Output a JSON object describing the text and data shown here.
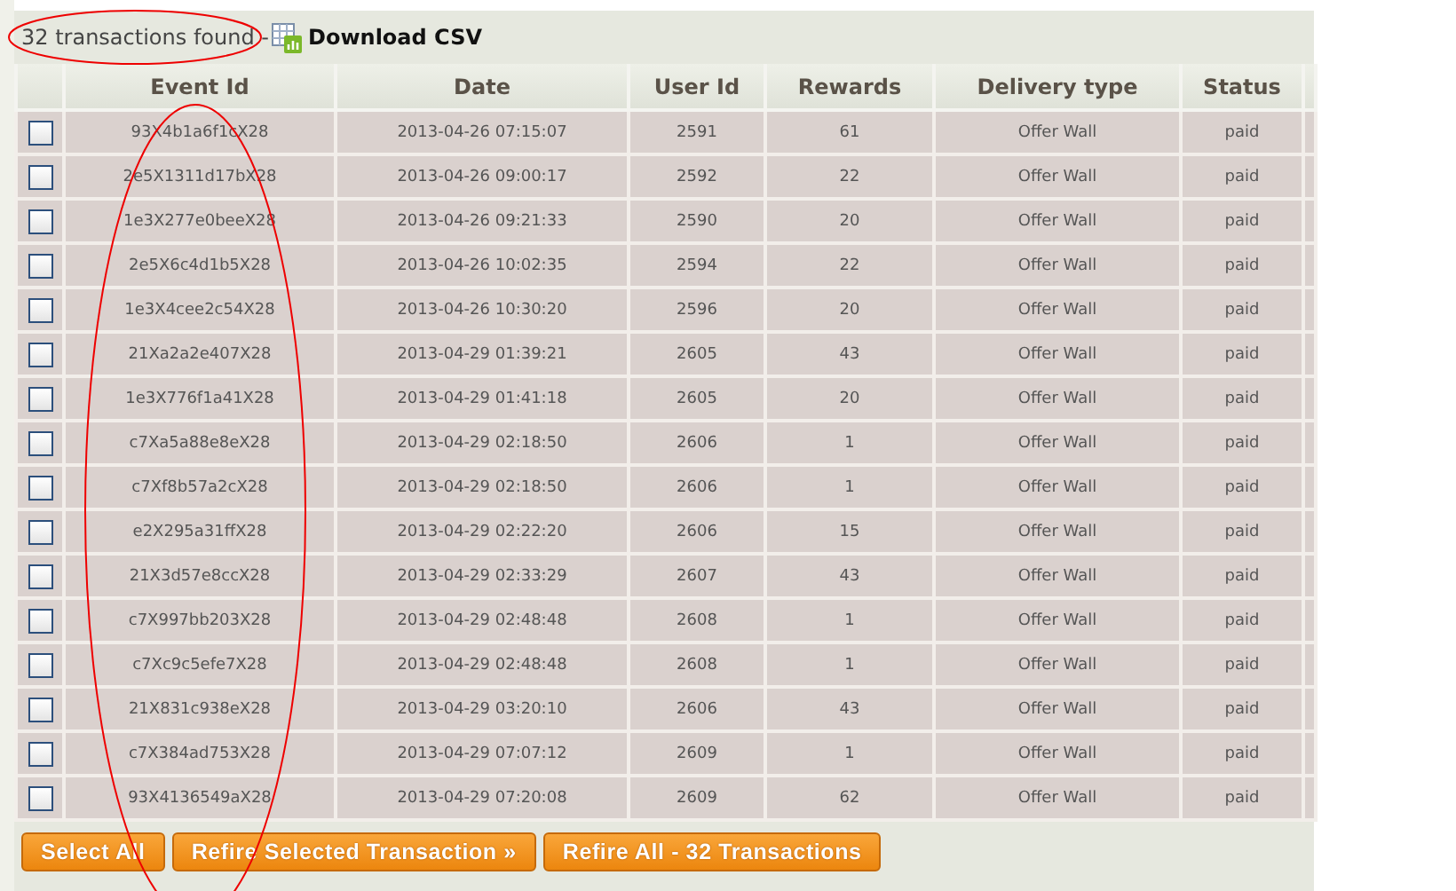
{
  "summary": {
    "count_text": "32 transactions found -",
    "download_link": "Download CSV"
  },
  "table": {
    "columns": [
      "Event Id",
      "Date",
      "User Id",
      "Rewards",
      "Delivery type",
      "Status"
    ],
    "rows": [
      {
        "checked": false,
        "event_id": "93X4b1a6f1cX28",
        "date": "2013-04-26 07:15:07",
        "user_id": "2591",
        "rewards": "61",
        "delivery_type": "Offer Wall",
        "status": "paid"
      },
      {
        "checked": false,
        "event_id": "2e5X1311d17bX28",
        "date": "2013-04-26 09:00:17",
        "user_id": "2592",
        "rewards": "22",
        "delivery_type": "Offer Wall",
        "status": "paid"
      },
      {
        "checked": false,
        "event_id": "1e3X277e0beeX28",
        "date": "2013-04-26 09:21:33",
        "user_id": "2590",
        "rewards": "20",
        "delivery_type": "Offer Wall",
        "status": "paid"
      },
      {
        "checked": false,
        "event_id": "2e5X6c4d1b5X28",
        "date": "2013-04-26 10:02:35",
        "user_id": "2594",
        "rewards": "22",
        "delivery_type": "Offer Wall",
        "status": "paid"
      },
      {
        "checked": false,
        "event_id": "1e3X4cee2c54X28",
        "date": "2013-04-26 10:30:20",
        "user_id": "2596",
        "rewards": "20",
        "delivery_type": "Offer Wall",
        "status": "paid"
      },
      {
        "checked": false,
        "event_id": "21Xa2a2e407X28",
        "date": "2013-04-29 01:39:21",
        "user_id": "2605",
        "rewards": "43",
        "delivery_type": "Offer Wall",
        "status": "paid"
      },
      {
        "checked": false,
        "event_id": "1e3X776f1a41X28",
        "date": "2013-04-29 01:41:18",
        "user_id": "2605",
        "rewards": "20",
        "delivery_type": "Offer Wall",
        "status": "paid"
      },
      {
        "checked": false,
        "event_id": "c7Xa5a88e8eX28",
        "date": "2013-04-29 02:18:50",
        "user_id": "2606",
        "rewards": "1",
        "delivery_type": "Offer Wall",
        "status": "paid"
      },
      {
        "checked": false,
        "event_id": "c7Xf8b57a2cX28",
        "date": "2013-04-29 02:18:50",
        "user_id": "2606",
        "rewards": "1",
        "delivery_type": "Offer Wall",
        "status": "paid"
      },
      {
        "checked": false,
        "event_id": "e2X295a31ffX28",
        "date": "2013-04-29 02:22:20",
        "user_id": "2606",
        "rewards": "15",
        "delivery_type": "Offer Wall",
        "status": "paid"
      },
      {
        "checked": false,
        "event_id": "21X3d57e8ccX28",
        "date": "2013-04-29 02:33:29",
        "user_id": "2607",
        "rewards": "43",
        "delivery_type": "Offer Wall",
        "status": "paid"
      },
      {
        "checked": false,
        "event_id": "c7X997bb203X28",
        "date": "2013-04-29 02:48:48",
        "user_id": "2608",
        "rewards": "1",
        "delivery_type": "Offer Wall",
        "status": "paid"
      },
      {
        "checked": false,
        "event_id": "c7Xc9c5efe7X28",
        "date": "2013-04-29 02:48:48",
        "user_id": "2608",
        "rewards": "1",
        "delivery_type": "Offer Wall",
        "status": "paid"
      },
      {
        "checked": false,
        "event_id": "21X831c938eX28",
        "date": "2013-04-29 03:20:10",
        "user_id": "2606",
        "rewards": "43",
        "delivery_type": "Offer Wall",
        "status": "paid"
      },
      {
        "checked": false,
        "event_id": "c7X384ad753X28",
        "date": "2013-04-29 07:07:12",
        "user_id": "2609",
        "rewards": "1",
        "delivery_type": "Offer Wall",
        "status": "paid"
      },
      {
        "checked": false,
        "event_id": "93X4136549aX28",
        "date": "2013-04-29 07:20:08",
        "user_id": "2609",
        "rewards": "62",
        "delivery_type": "Offer Wall",
        "status": "paid"
      }
    ]
  },
  "buttons": [
    "Select All",
    "Refire Selected Transaction »",
    "Refire All - 32 Transactions"
  ]
}
